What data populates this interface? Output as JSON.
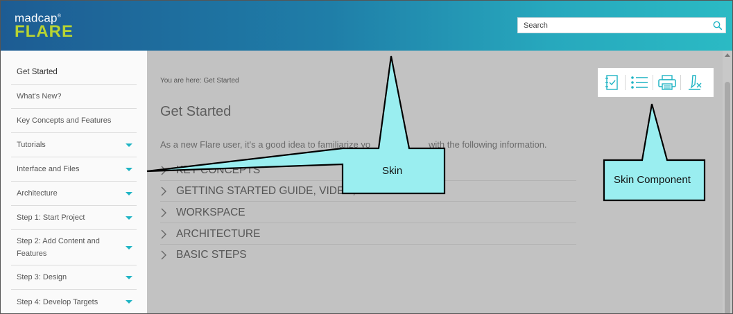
{
  "header": {
    "logo_top": "madcap",
    "logo_reg": "®",
    "logo_main": "FLARE",
    "search_placeholder": "Search"
  },
  "sidebar": {
    "items": [
      {
        "label": "Get Started",
        "active": true,
        "expandable": false
      },
      {
        "label": "What's New?",
        "expandable": false
      },
      {
        "label": "Key Concepts and Features",
        "expandable": false
      },
      {
        "label": "Tutorials",
        "expandable": true
      },
      {
        "label": "Interface and Files",
        "expandable": true
      },
      {
        "label": "Architecture",
        "expandable": true
      },
      {
        "label": "Step 1: Start Project",
        "expandable": true
      },
      {
        "label": "Step 2: Add Content and Features",
        "expandable": true
      },
      {
        "label": "Step 3: Design",
        "expandable": true
      },
      {
        "label": "Step 4: Develop Targets",
        "expandable": true
      }
    ]
  },
  "main": {
    "breadcrumb": "You are here: Get Started",
    "title": "Get Started",
    "intro": "As a new Flare user, it's a good idea to familiarize yo",
    "intro_tail": "with the following information.",
    "sections": [
      "KEY CONCEPTS",
      "GETTING STARTED GUIDE, VIDEO, AND TUTORIAL",
      "WORKSPACE",
      "ARCHITECTURE",
      "BASIC STEPS"
    ]
  },
  "toolbar": {
    "icons": [
      "toc-icon",
      "list-icon",
      "print-icon",
      "remove-highlight-icon"
    ]
  },
  "callouts": {
    "skin": "Skin",
    "skin_component": "Skin Component"
  },
  "colors": {
    "accent": "#1fb4c4",
    "callout_fill": "#9aeef0",
    "logo_green": "#b8d432",
    "content_overlay": "#c2c2c2"
  }
}
